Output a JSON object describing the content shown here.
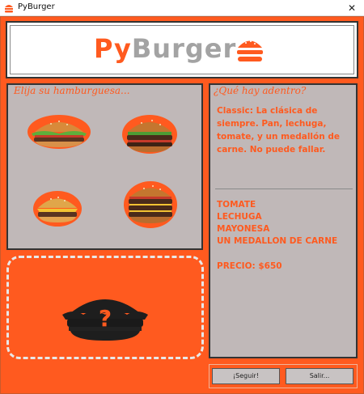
{
  "window": {
    "title": "PyBurger",
    "close_glyph": "✕"
  },
  "logo": {
    "text_py": "Py",
    "text_burger": "Burger",
    "icon": "burger-icon"
  },
  "menu": {
    "title": "Elija su hamburguesa...",
    "items": [
      {
        "name": "burger-classic"
      },
      {
        "name": "burger-bbq"
      },
      {
        "name": "burger-cheese"
      },
      {
        "name": "burger-triple"
      }
    ]
  },
  "info": {
    "title": "¿Qué hay adentro?",
    "description": "Classic: La clásica de siempre. Pan, lechuga, tomate, y un medallón de carne. No puede fallar.",
    "ingredients": [
      "TOMATE",
      "LECHUGA",
      "MAYONESA",
      "UN MEDALLON DE CARNE"
    ],
    "price": "PRECIO: $650"
  },
  "preview": {
    "question_mark": "?"
  },
  "buttons": {
    "next": "¡Seguir!",
    "exit": "Salir..."
  },
  "colors": {
    "accent": "#ff5a1f",
    "panel": "#c0b8b8",
    "logo_gray": "#a3a3a3"
  }
}
